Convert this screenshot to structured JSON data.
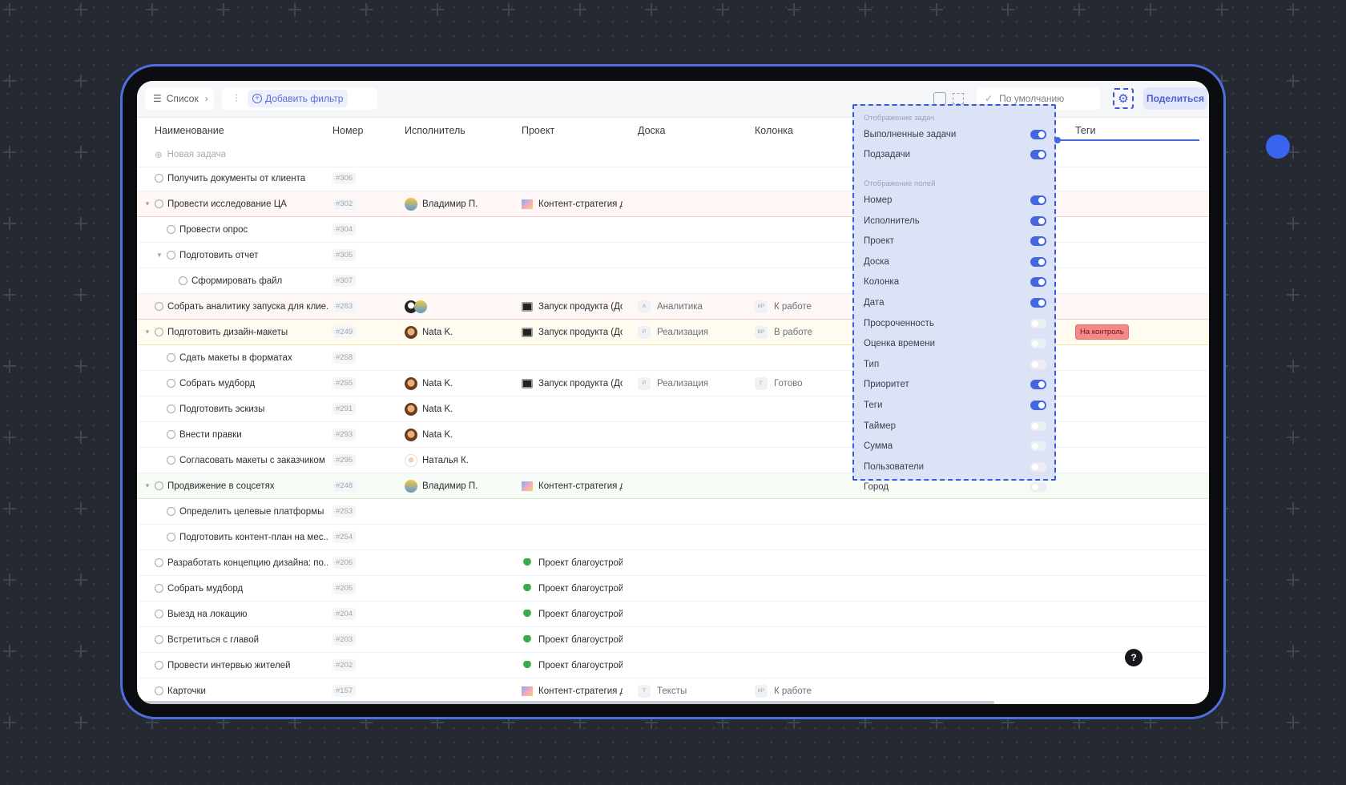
{
  "toolbar": {
    "view_label": "Список",
    "add_filter_label": "Добавить фильтр",
    "sort_default_label": "По умолчанию",
    "share_label": "Поделиться"
  },
  "columns": [
    "Наименование",
    "Номер",
    "Исполнитель",
    "Проект",
    "Доска",
    "Колонка",
    "Теги"
  ],
  "new_task_label": "Новая задача",
  "tasks": [
    {
      "name": "Получить документы от клиента",
      "num": "#306"
    },
    {
      "name": "Провести исследование ЦА",
      "num": "#302",
      "assignee": "Владимир П.",
      "project": "Контент-стратегия дл"
    },
    {
      "name": "Провести опрос",
      "num": "#304"
    },
    {
      "name": "Подготовить отчет",
      "num": "#305"
    },
    {
      "name": "Сформировать файл",
      "num": "#307"
    },
    {
      "name": "Собрать аналитику запуска для клие...",
      "num": "#283",
      "project": "Запуск продукта (Док",
      "board": "Аналитика",
      "board_abbr": "А",
      "column": "К работе",
      "column_abbr": "КР"
    },
    {
      "name": "Подготовить дизайн-макеты",
      "num": "#249",
      "assignee": "Nata K.",
      "project": "Запуск продукта (Док",
      "board": "Реализация",
      "board_abbr": "Р",
      "column": "В работе",
      "column_abbr": "ВР",
      "tag": "На контроль"
    },
    {
      "name": "Сдать макеты в форматах",
      "num": "#258"
    },
    {
      "name": "Собрать мудборд",
      "num": "#255",
      "assignee": "Nata K.",
      "project": "Запуск продукта (Док",
      "board": "Реализация",
      "board_abbr": "Р",
      "column": "Готово",
      "column_abbr": "Г"
    },
    {
      "name": "Подготовить эскизы",
      "num": "#291",
      "assignee": "Nata K."
    },
    {
      "name": "Внести правки",
      "num": "#293",
      "assignee": "Nata K."
    },
    {
      "name": "Согласовать макеты с заказчиком",
      "num": "#295",
      "assignee": "Наталья К."
    },
    {
      "name": "Продвижение в соцсетях",
      "num": "#248",
      "assignee": "Владимир П.",
      "project": "Контент-стратегия дл"
    },
    {
      "name": "Определить целевые платформы",
      "num": "#253"
    },
    {
      "name": "Подготовить контент-план на мес...",
      "num": "#254"
    },
    {
      "name": "Разработать концепцию дизайна: по...",
      "num": "#206",
      "project": "Проект благоустройс"
    },
    {
      "name": "Собрать мудборд",
      "num": "#205",
      "project": "Проект благоустройс"
    },
    {
      "name": "Выезд на локацию",
      "num": "#204",
      "project": "Проект благоустройс"
    },
    {
      "name": "Встретиться с главой",
      "num": "#203",
      "project": "Проект благоустройс"
    },
    {
      "name": "Провести интервью жителей",
      "num": "#202",
      "project": "Проект благоустройс"
    },
    {
      "name": "Карточки",
      "num": "#157",
      "project": "Контент-стратегия дл",
      "board": "Тексты",
      "board_abbr": "Т",
      "column": "К работе",
      "column_abbr": "КР"
    }
  ],
  "settings": {
    "tasks_section": "Отображение задач",
    "task_options": [
      {
        "label": "Выполненные задачи",
        "on": true
      },
      {
        "label": "Подзадачи",
        "on": true
      }
    ],
    "fields_section": "Отображение полей",
    "field_options": [
      {
        "label": "Номер",
        "on": true
      },
      {
        "label": "Исполнитель",
        "on": true
      },
      {
        "label": "Проект",
        "on": true
      },
      {
        "label": "Доска",
        "on": true
      },
      {
        "label": "Колонка",
        "on": true
      },
      {
        "label": "Дата",
        "on": true
      },
      {
        "label": "Просроченность",
        "on": false
      },
      {
        "label": "Оценка времени",
        "on": false
      },
      {
        "label": "Тип",
        "on": false
      },
      {
        "label": "Приоритет",
        "on": true
      },
      {
        "label": "Теги",
        "on": true
      },
      {
        "label": "Таймер",
        "on": false
      },
      {
        "label": "Сумма",
        "on": false
      },
      {
        "label": "Пользователи",
        "on": false
      },
      {
        "label": "Город",
        "on": false
      }
    ]
  },
  "help_label": "?",
  "colors": {
    "accent": "#4466df",
    "tag_red": "#f28a8a"
  }
}
